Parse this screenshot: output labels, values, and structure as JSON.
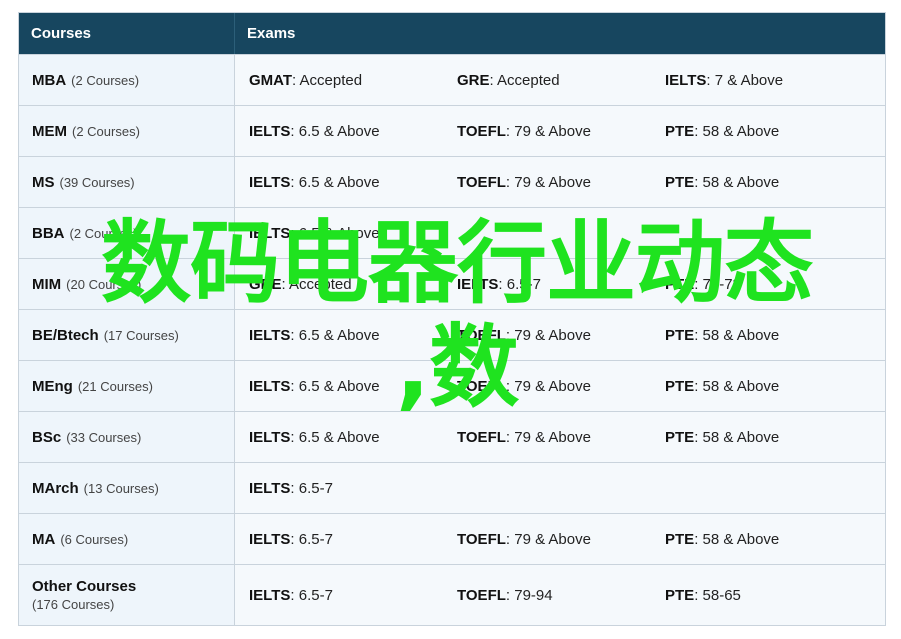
{
  "header": {
    "courses": "Courses",
    "exams": "Exams"
  },
  "rows": [
    {
      "name": "MBA",
      "count": "(2 Courses)",
      "exams": [
        {
          "name": "GMAT",
          "value": ": Accepted"
        },
        {
          "name": "GRE",
          "value": ": Accepted"
        },
        {
          "name": "IELTS",
          "value": ": 7 & Above"
        }
      ]
    },
    {
      "name": "MEM",
      "count": "(2 Courses)",
      "exams": [
        {
          "name": "IELTS",
          "value": ": 6.5 & Above"
        },
        {
          "name": "TOEFL",
          "value": ": 79 & Above"
        },
        {
          "name": "PTE",
          "value": ": 58 & Above"
        }
      ]
    },
    {
      "name": "MS",
      "count": "(39 Courses)",
      "exams": [
        {
          "name": "IELTS",
          "value": ": 6.5 & Above"
        },
        {
          "name": "TOEFL",
          "value": ": 79 & Above"
        },
        {
          "name": "PTE",
          "value": ": 58 & Above"
        }
      ]
    },
    {
      "name": "BBA",
      "count": "(2 Courses)",
      "exams": [
        {
          "name": "IELTS",
          "value": ": 6.5 & Above"
        },
        {
          "name": "",
          "value": ""
        },
        {
          "name": "",
          "value": ""
        }
      ]
    },
    {
      "name": "MIM",
      "count": "(20 Courses)",
      "exams": [
        {
          "name": "GRE",
          "value": ": Accepted"
        },
        {
          "name": "IELTS",
          "value": ": 6.5-7"
        },
        {
          "name": "PTE",
          "value": ": 70-73"
        }
      ]
    },
    {
      "name": "BE/Btech",
      "count": "(17 Courses)",
      "exams": [
        {
          "name": "IELTS",
          "value": ": 6.5 & Above"
        },
        {
          "name": "TOEFL",
          "value": ": 79 & Above"
        },
        {
          "name": "PTE",
          "value": ": 58 & Above"
        }
      ]
    },
    {
      "name": "MEng",
      "count": "(21 Courses)",
      "exams": [
        {
          "name": "IELTS",
          "value": ": 6.5 & Above"
        },
        {
          "name": "TOEFL",
          "value": ": 79 & Above"
        },
        {
          "name": "PTE",
          "value": ": 58 & Above"
        }
      ]
    },
    {
      "name": "BSc",
      "count": "(33 Courses)",
      "exams": [
        {
          "name": "IELTS",
          "value": ": 6.5 & Above"
        },
        {
          "name": "TOEFL",
          "value": ": 79 & Above"
        },
        {
          "name": "PTE",
          "value": ": 58 & Above"
        }
      ]
    },
    {
      "name": "MArch",
      "count": "(13 Courses)",
      "exams": [
        {
          "name": "IELTS",
          "value": ": 6.5-7"
        },
        {
          "name": "",
          "value": ""
        },
        {
          "name": "",
          "value": ""
        }
      ]
    },
    {
      "name": "MA",
      "count": "(6 Courses)",
      "exams": [
        {
          "name": "IELTS",
          "value": ": 6.5-7"
        },
        {
          "name": "TOEFL",
          "value": ": 79 & Above"
        },
        {
          "name": "PTE",
          "value": ": 58 & Above"
        }
      ]
    },
    {
      "name": "Other Courses",
      "count": "(176 Courses)",
      "exams": [
        {
          "name": "IELTS",
          "value": ": 6.5-7"
        },
        {
          "name": "TOEFL",
          "value": ": 79-94"
        },
        {
          "name": "PTE",
          "value": ": 58-65"
        }
      ]
    }
  ],
  "overlay": {
    "line1": "数码电器行业动态",
    "line2": ",数"
  },
  "colors": {
    "header_bg": "#17465f",
    "overlay_text": "#1fe31f"
  }
}
